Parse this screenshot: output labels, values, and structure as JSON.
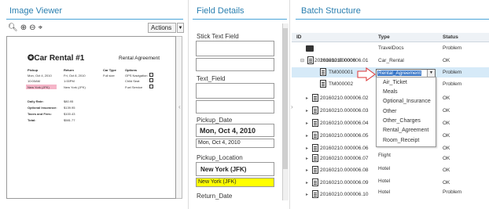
{
  "panels": {
    "image_viewer": {
      "title": "Image Viewer",
      "actions_label": "Actions"
    },
    "field_details": {
      "title": "Field Details"
    },
    "batch_structure": {
      "title": "Batch Structure"
    }
  },
  "zoom_icons": [
    "zoom-fit-icon",
    "zoom-in-icon",
    "zoom-out-icon",
    "zoom-select-icon"
  ],
  "document": {
    "logo": "✪Car Rental #1",
    "subtitle": "Rental Agreement",
    "headers": [
      "Pickup",
      "Return",
      "Car Type",
      "Options"
    ],
    "rows": [
      [
        "Mon, Oct 4, 2010",
        "Fri, Oct 8, 2010",
        "Full size",
        "GPS Navigation"
      ],
      [
        "10:00AM",
        "1:00PM",
        "",
        "Child Seat"
      ],
      [
        "New York (JFK)",
        "New York (JFK)",
        "",
        "Fuel Service"
      ]
    ],
    "summary": [
      [
        "Daily Rate:",
        "$80.95"
      ],
      [
        "Optional Insurance:",
        "$139.95"
      ],
      [
        "Taxes and Fees:",
        "$100.43"
      ],
      [
        "Total:",
        "$581.77"
      ]
    ]
  },
  "fields": {
    "stick_text": {
      "label": "Stick Text Field"
    },
    "text_field": {
      "label": "Text_Field"
    },
    "pickup_date": {
      "label": "Pickup_Date",
      "snippet": "Mon, Oct 4, 2010",
      "value": "Mon, Oct 4, 2010"
    },
    "pickup_location": {
      "label": "Pickup_Location",
      "snippet": "New York (JFK)",
      "value": "New York (JFK)"
    },
    "return_date": {
      "label": "Return_Date"
    }
  },
  "batch": {
    "columns": {
      "id": "ID",
      "type": "Type",
      "status": "Status"
    },
    "rows": [
      {
        "id": "",
        "type": "TravelDocs",
        "status": "Problem"
      },
      {
        "id": "20160210.000006",
        "type": "",
        "status": ""
      },
      {
        "id": "20160210.000006.01",
        "type": "Car_Rental",
        "status": "OK"
      },
      {
        "id": "TM000001",
        "type": "Rental_Agreement",
        "status": "Problem"
      },
      {
        "id": "TM000002",
        "type": "",
        "status": "Problem"
      },
      {
        "id": "20160210.000006.02",
        "type": "",
        "status": "OK"
      },
      {
        "id": "20160210.000006.03",
        "type": "",
        "status": "OK"
      },
      {
        "id": "20160210.000006.04",
        "type": "",
        "status": "OK"
      },
      {
        "id": "20160210.000006.05",
        "type": "",
        "status": "OK"
      },
      {
        "id": "20160210.000006.06",
        "type": "",
        "status": "OK"
      },
      {
        "id": "20160210.000006.07",
        "type": "Flight",
        "status": "OK"
      },
      {
        "id": "20160210.000006.08",
        "type": "Hotel",
        "status": "OK"
      },
      {
        "id": "20160210.000006.09",
        "type": "Hotel",
        "status": "OK"
      },
      {
        "id": "20160210.000006.10",
        "type": "Hotel",
        "status": "Problem"
      }
    ],
    "type_options": [
      "Air_Ticket",
      "Meals",
      "Optional_Insurance",
      "Other",
      "Other_Charges",
      "Rental_Agreement",
      "Room_Receipt"
    ]
  },
  "colors": {
    "accent": "#2a7fb0",
    "highlight_yellow": "#ffff00",
    "selected_row": "#d6eaf8",
    "callout_red": "#d33"
  }
}
